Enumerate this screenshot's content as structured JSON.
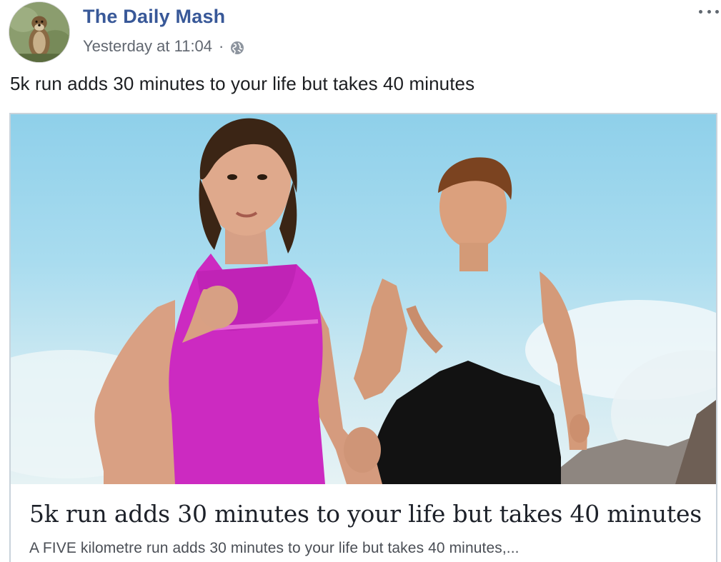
{
  "post": {
    "page_name": "The Daily Mash",
    "timestamp": "Yesterday at 11:04",
    "separator": "·",
    "privacy_icon": "globe-icon",
    "more_icon": "ellipsis-icon",
    "text": "5k run adds 30 minutes to your life but takes 40 minutes"
  },
  "link": {
    "title": "5k run adds 30 minutes to your life but takes 40 minutes",
    "description": "A FIVE kilometre run adds 30 minutes to your life but takes 40 minutes,..."
  },
  "colors": {
    "page_name": "#385898",
    "secondary_text": "#616770",
    "card_border": "#c9d3db"
  }
}
